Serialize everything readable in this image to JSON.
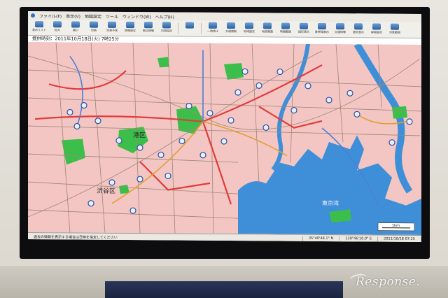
{
  "window": {
    "menu_items": [
      "ファイル(F)",
      "表示(V)",
      "地図設定",
      "ツール",
      "ウィンドウ(W)",
      "ヘルプ(H)"
    ]
  },
  "toolbar": {
    "buttons": [
      {
        "label": "表示リスト",
        "icon": "list-icon"
      },
      {
        "label": "拡大",
        "icon": "zoom-in-icon"
      },
      {
        "label": "縮小",
        "icon": "zoom-out-icon"
      },
      {
        "label": "印刷",
        "icon": "print-icon"
      },
      {
        "label": "渋滞予測",
        "icon": "traffic-forecast-icon"
      },
      {
        "label": "情報設定",
        "icon": "info-settings-icon"
      },
      {
        "label": "拠点情報",
        "icon": "site-info-icon"
      },
      {
        "label": "日時指定",
        "icon": "calendar-icon"
      },
      {
        "label": "",
        "icon": "blank-icon"
      },
      {
        "label": "一時停止",
        "icon": "pause-icon"
      },
      {
        "label": "交通規制",
        "icon": "regulation-icon"
      },
      {
        "label": "地域設定",
        "icon": "region-icon"
      },
      {
        "label": "地図画面",
        "icon": "map-screen-icon"
      },
      {
        "label": "時間範囲",
        "icon": "time-range-icon"
      },
      {
        "label": "図形表示",
        "icon": "shape-icon"
      },
      {
        "label": "駐車場表示",
        "icon": "parking-icon"
      },
      {
        "label": "交通情報",
        "icon": "traffic-info-icon"
      },
      {
        "label": "設定表示",
        "icon": "settings-icon"
      },
      {
        "label": "詳細設定",
        "icon": "details-icon"
      },
      {
        "label": "対象範囲",
        "icon": "range-icon"
      }
    ]
  },
  "infobar": {
    "text": "提供時刻：2011年10月18日(火) 7時25分"
  },
  "map": {
    "labels": [
      {
        "text": "渋谷区"
      },
      {
        "text": "港区"
      },
      {
        "text": "東京湾"
      }
    ],
    "scale_label": "1km",
    "colors": {
      "land": "#f3c6c3",
      "water": "#3f8fd8",
      "park": "#3cbf4a",
      "road_major": "#e23b3b",
      "road_minor": "#8c7a6a"
    }
  },
  "statusbar": {
    "message": "過去の情報を表示する場合は日時を指定してください",
    "coords": "35°40'48.1\" N",
    "coords2": "139°46'10.0\" E",
    "timestamp": "2011/10/18 07:25"
  },
  "watermark": {
    "text": "Response."
  }
}
